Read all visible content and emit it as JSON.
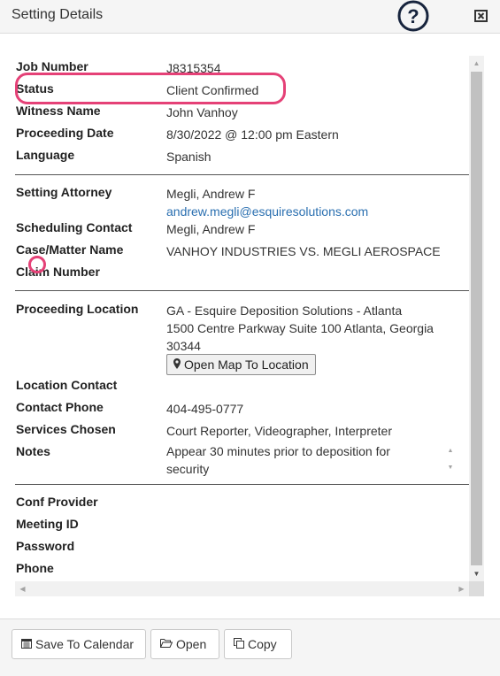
{
  "header": {
    "title": "Setting Details"
  },
  "fields": {
    "job_number": {
      "label": "Job Number",
      "value": "J8315354"
    },
    "status": {
      "label": "Status",
      "value": "Client Confirmed"
    },
    "witness_name": {
      "label": "Witness Name",
      "value": "John Vanhoy"
    },
    "proceeding_date": {
      "label": "Proceeding Date",
      "value": "8/30/2022 @ 12:00 pm Eastern"
    },
    "language": {
      "label": "Language",
      "value": "Spanish"
    },
    "setting_attorney": {
      "label": "Setting Attorney",
      "value": "Megli, Andrew F",
      "email": "andrew.megli@esquiresolutions.com"
    },
    "scheduling_contact": {
      "label": "Scheduling Contact",
      "value": "Megli, Andrew F"
    },
    "case_matter_name": {
      "label": "Case/Matter Name",
      "value": "VANHOY INDUSTRIES VS. MEGLI AEROSPACE"
    },
    "claim_number": {
      "label": "Claim Number",
      "value": ""
    },
    "proceeding_location": {
      "label": "Proceeding Location",
      "line1": "GA - Esquire Deposition Solutions - Atlanta",
      "line2": "1500 Centre Parkway Suite 100 Atlanta, Georgia",
      "line3": "30344",
      "map_button": "Open Map To Location"
    },
    "location_contact": {
      "label": "Location Contact",
      "value": ""
    },
    "contact_phone": {
      "label": "Contact Phone",
      "value": "404-495-0777"
    },
    "services_chosen": {
      "label": "Services Chosen",
      "value": "Court Reporter, Videographer, Interpreter"
    },
    "notes": {
      "label": "Notes",
      "value": "Appear 30 minutes prior to deposition for security"
    },
    "conf_provider": {
      "label": "Conf Provider",
      "value": ""
    },
    "meeting_id": {
      "label": "Meeting ID",
      "value": ""
    },
    "password": {
      "label": "Password",
      "value": ""
    },
    "phone": {
      "label": "Phone",
      "value": ""
    }
  },
  "footer": {
    "save_to_calendar": "Save To Calendar",
    "open": "Open",
    "copy": "Copy"
  },
  "icons": {
    "help": "help-circle-icon",
    "close": "close-box-icon",
    "map_pin": "map-marker-icon",
    "calendar": "calendar-icon",
    "folder": "folder-open-icon",
    "copy": "copy-icon"
  },
  "colors": {
    "highlight": "#e54177",
    "link": "#2a6fb0",
    "help_icon": "#17243d"
  }
}
